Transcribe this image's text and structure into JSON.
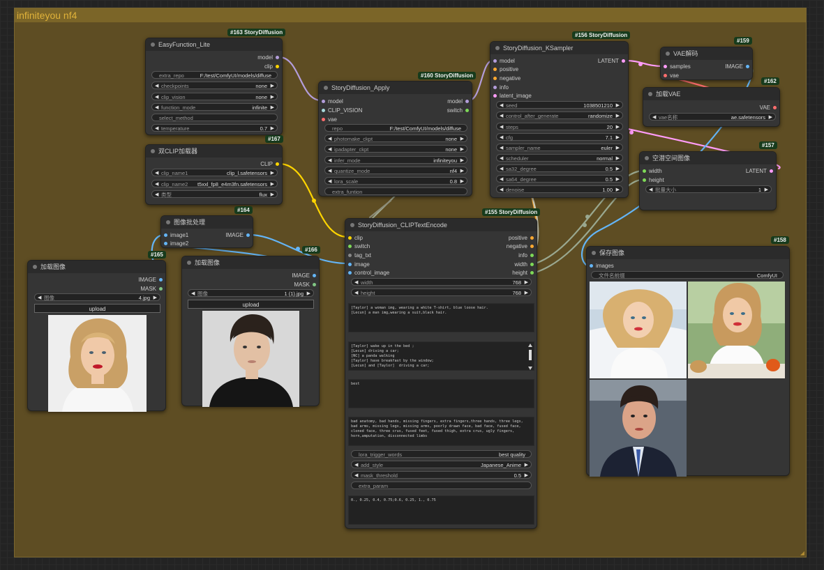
{
  "group": {
    "title": "infiniteyou nf4"
  },
  "nodes": {
    "easy": {
      "badge": "#163 StoryDiffusion",
      "title": "EasyFunction_Lite",
      "outputs": [
        "model",
        "clip"
      ],
      "widgets": [
        {
          "label": "extra_repo",
          "value": "F:/test/ComfyUI/models/diffuse"
        },
        {
          "label": "checkpoints",
          "value": "none"
        },
        {
          "label": "clip_vision",
          "value": "none"
        },
        {
          "label": "function_mode",
          "value": "infinite"
        },
        {
          "label": "select_method",
          "value": ""
        },
        {
          "label": "temperature",
          "value": "0.7"
        }
      ]
    },
    "dualclip": {
      "badge": "#167",
      "title": "双CLIP加载器",
      "outputs": [
        "CLIP"
      ],
      "widgets": [
        {
          "label": "clip_name1",
          "value": "clip_l.safetensors"
        },
        {
          "label": "clip_name2",
          "value": "t5xxl_fp8_e4m3fn.safetensors"
        },
        {
          "label": "类型",
          "value": "flux"
        }
      ]
    },
    "batch": {
      "badge": "#164",
      "title": "图像批处理",
      "inputs": [
        "image1",
        "image2"
      ],
      "outputs": [
        "IMAGE"
      ]
    },
    "load1": {
      "badge": "#165",
      "title": "加载图像",
      "outputs": [
        "IMAGE",
        "MASK"
      ],
      "widget": {
        "label": "图像",
        "value": "4.jpg"
      },
      "upload": "upload"
    },
    "load2": {
      "badge": "#166",
      "title": "加载图像",
      "outputs": [
        "IMAGE",
        "MASK"
      ],
      "widget": {
        "label": "图像",
        "value": "1 (1).jpg"
      },
      "upload": "upload"
    },
    "apply": {
      "badge": "#160 StoryDiffusion",
      "title": "StoryDiffusion_Apply",
      "inputs": [
        "model",
        "CLIP_VISION",
        "vae"
      ],
      "outputs": [
        "model",
        "switch"
      ],
      "widgets": [
        {
          "label": "repo",
          "value": "F:/test/ComfyUI/models/diffuse"
        },
        {
          "label": "photomake_ckpt",
          "value": "none"
        },
        {
          "label": "ipadapter_ckpt",
          "value": "none"
        },
        {
          "label": "infer_mode",
          "value": "infiniteyou"
        },
        {
          "label": "quantize_mode",
          "value": "nf4"
        },
        {
          "label": "lora_scale",
          "value": "0.8"
        },
        {
          "label": "extra_funtion",
          "value": ""
        }
      ]
    },
    "ksampler": {
      "badge": "#156 StoryDiffusion",
      "title": "StoryDiffusion_KSampler",
      "inputs": [
        "model",
        "positive",
        "negative",
        "info",
        "latent_image"
      ],
      "outputs": [
        "LATENT"
      ],
      "widgets": [
        {
          "label": "seed",
          "value": "1038501210"
        },
        {
          "label": "control_after_generate",
          "value": "randomize"
        },
        {
          "label": "steps",
          "value": "20"
        },
        {
          "label": "cfg",
          "value": "7.1"
        },
        {
          "label": "sampler_name",
          "value": "euler"
        },
        {
          "label": "scheduler",
          "value": "normal"
        },
        {
          "label": "sa32_degree",
          "value": "0.5"
        },
        {
          "label": "sa64_degree",
          "value": "0.5"
        },
        {
          "label": "denoise",
          "value": "1.00"
        }
      ]
    },
    "vaedecode": {
      "badge": "#159",
      "title": "VAE解码",
      "inputs": [
        "samples",
        "vae"
      ],
      "outputs": [
        "IMAGE"
      ]
    },
    "vaeload": {
      "badge": "#162",
      "title": "加载VAE",
      "outputs": [
        "VAE"
      ],
      "widget": {
        "label": "vae名称",
        "value": "ae.safetensors"
      }
    },
    "latent": {
      "badge": "#157",
      "title": "空潜空间图像",
      "inputs": [
        "width",
        "height"
      ],
      "outputs": [
        "LATENT"
      ],
      "widget": {
        "label": "批量大小",
        "value": "1"
      }
    },
    "clipenc": {
      "badge": "#155 StoryDiffusion",
      "title": "StoryDiffusion_CLIPTextEncode",
      "inputs": [
        "clip",
        "switch",
        "tag_txt",
        "image",
        "control_image"
      ],
      "outputs": [
        "positive",
        "negative",
        "info",
        "width",
        "height"
      ],
      "widgets": [
        {
          "label": "width",
          "value": "768"
        },
        {
          "label": "height",
          "value": "768"
        }
      ],
      "text_char": "[Taylor] a woman img, wearing a white T-shirt, blue loose hair.\n[Lecun] a man img,wearing a suit,black hair.",
      "text_scene": "[Taylor] wake up in the bed ;\n[Lecun] driving a car;\n[NC] a panda walking\n[Taylor] have breakfast by the window;\n[Lecun] and [Taylor]  driving a car;",
      "text_style": "best",
      "text_neg": "bad anatomy, bad hands, missing fingers, extra fingers,three hands, three legs, bad arms, missing legs, missing arms, poorly drawn face, bad face, fused face, cloned face, three crus, fused feet, fused thigh, extra crus, ugly fingers, horn,amputation, disconnected limbs",
      "widgets2": [
        {
          "label": "lora_trigger_words",
          "value": "best quality"
        },
        {
          "label": "add_style",
          "value": "Japanese_Anime"
        },
        {
          "label": "mask_threshold",
          "value": "0.5"
        },
        {
          "label": "extra_param",
          "value": ""
        }
      ],
      "text_extra": "0., 0.25, 0.4, 0.75;0.6, 0.25, 1., 0.75"
    },
    "save": {
      "badge": "#158",
      "title": "保存图像",
      "inputs": [
        "images"
      ],
      "widget": {
        "label": "文件名前缀",
        "value": "ComfyUI"
      }
    }
  },
  "colors": {
    "model": "#b39ddb",
    "clip": "#ffd500",
    "vae": "#ff6e6e",
    "image": "#64b5f6",
    "latent": "#ff9cf9",
    "conditioning": "#ffa931",
    "int": "#7ed957",
    "mask": "#81c784",
    "clip_vision": "#a8dadc",
    "group": "#5e4d23"
  }
}
